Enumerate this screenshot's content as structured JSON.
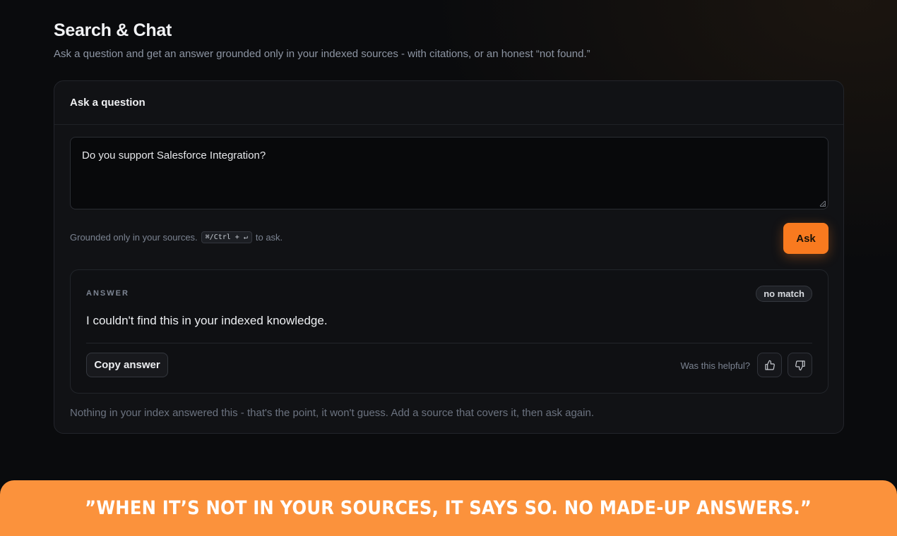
{
  "header": {
    "title": "Search & Chat",
    "subtitle": "Ask a question and get an answer grounded only in your indexed sources - with citations, or an honest “not found.”"
  },
  "ask_card": {
    "title": "Ask a question",
    "question_value": "Do you support Salesforce Integration?",
    "hint_prefix": "Grounded only in your sources.",
    "shortcut": "⌘/Ctrl + ↵",
    "hint_suffix": "to ask.",
    "ask_label": "Ask",
    "accent_color": "#f97a1f"
  },
  "answer": {
    "label": "ANSWER",
    "status_badge": "no match",
    "text": "I couldn't find this in your indexed knowledge.",
    "copy_label": "Copy answer",
    "helpful_label": "Was this helpful?",
    "thumbs_up_icon": "thumbs-up-icon",
    "thumbs_down_icon": "thumbs-down-icon"
  },
  "footnote": "Nothing in your index answered this - that's the point, it won't guess. Add a source that covers it, then ask again.",
  "banner": {
    "text": "”WHEN IT’S NOT IN YOUR SOURCES, IT SAYS SO. NO MADE-UP ANSWERS.”",
    "color": "#fb923c"
  }
}
